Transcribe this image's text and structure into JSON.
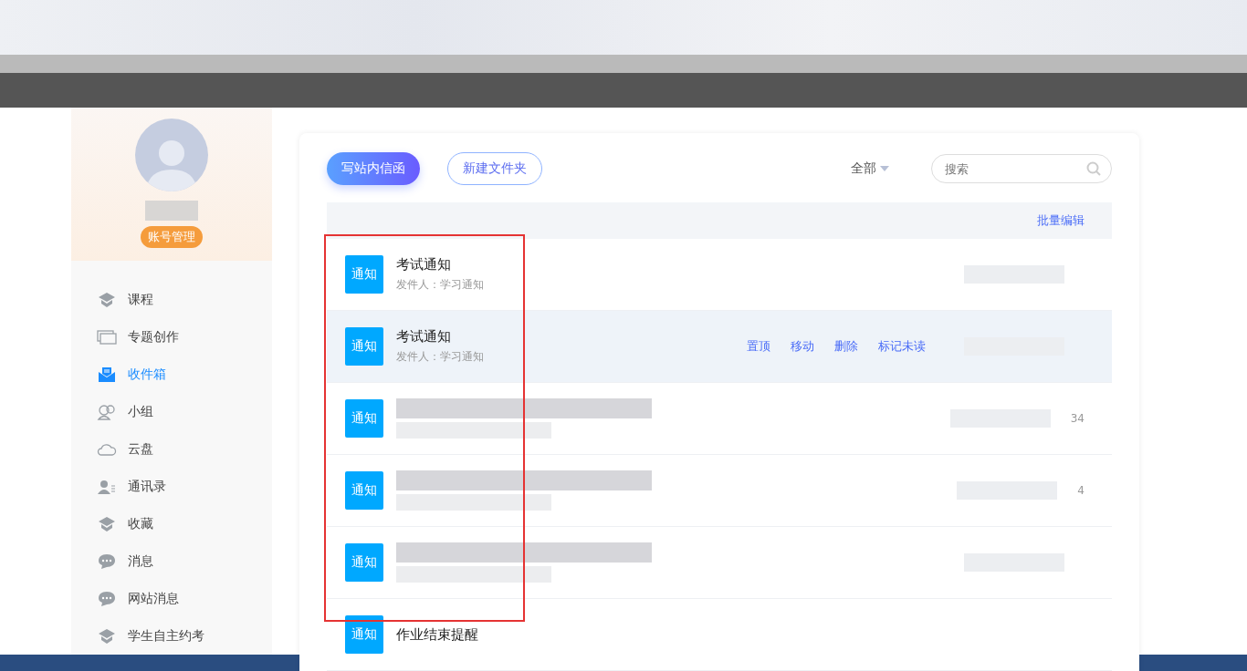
{
  "profile": {
    "account_button": "账号管理"
  },
  "sidebar": {
    "items": [
      {
        "label": "课程",
        "selected": false
      },
      {
        "label": "专题创作",
        "selected": false
      },
      {
        "label": "收件箱",
        "selected": true
      },
      {
        "label": "小组",
        "selected": false
      },
      {
        "label": "云盘",
        "selected": false
      },
      {
        "label": "通讯录",
        "selected": false
      },
      {
        "label": "收藏",
        "selected": false
      },
      {
        "label": "消息",
        "selected": false
      },
      {
        "label": "网站消息",
        "selected": false
      },
      {
        "label": "学生自主约考",
        "selected": false
      }
    ]
  },
  "toolbar": {
    "compose_button": "写站内信函",
    "new_folder_button": "新建文件夹",
    "filter": "全部",
    "search": {
      "placeholder": "搜索"
    }
  },
  "list_header": {
    "batch_edit": "批量编辑"
  },
  "messages": [
    {
      "kind": "plain",
      "badge": "通知",
      "title": "考试通知",
      "sender": "发件人：学习通知",
      "hovered": false
    },
    {
      "kind": "plain",
      "badge": "通知",
      "title": "考试通知",
      "sender": "发件人：学习通知",
      "hovered": true,
      "actions": [
        "置顶",
        "移动",
        "删除",
        "标记未读"
      ]
    },
    {
      "kind": "redacted",
      "badge": "通知",
      "time_tail": "34",
      "hovered": false
    },
    {
      "kind": "redacted",
      "badge": "通知",
      "time_tail": "4",
      "hovered": false
    },
    {
      "kind": "redacted",
      "badge": "通知",
      "hovered": false
    },
    {
      "kind": "plain",
      "badge": "通知",
      "title": "作业结束提醒",
      "hovered": false
    }
  ]
}
